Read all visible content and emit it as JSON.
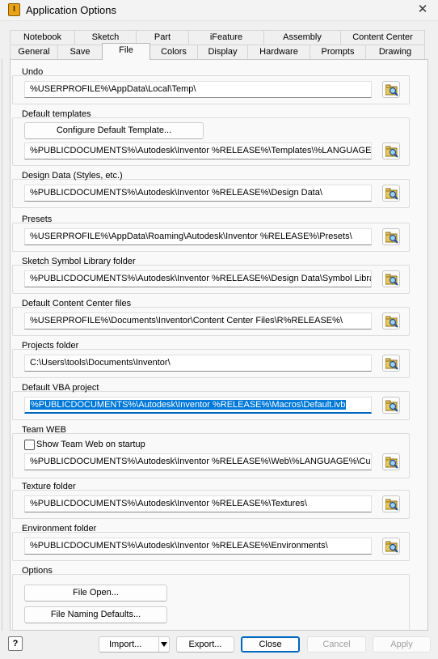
{
  "window": {
    "title": "Application Options",
    "close_glyph": "✕",
    "icon_letter": "I"
  },
  "tabs_back": [
    "Notebook",
    "Sketch",
    "Part",
    "iFeature",
    "Assembly",
    "Content Center"
  ],
  "tabs_front": [
    "General",
    "Save",
    "File",
    "Colors",
    "Display",
    "Hardware",
    "Prompts",
    "Drawing"
  ],
  "active_tab": "File",
  "groups": {
    "undo": {
      "label": "Undo",
      "value": "%USERPROFILE%\\AppData\\Local\\Temp\\"
    },
    "default_templates": {
      "label": "Default templates",
      "button": "Configure Default Template...",
      "value": "%PUBLICDOCUMENTS%\\Autodesk\\Inventor %RELEASE%\\Templates\\%LANGUAGE%\\"
    },
    "design_data": {
      "label": "Design Data (Styles, etc.)",
      "value": "%PUBLICDOCUMENTS%\\Autodesk\\Inventor %RELEASE%\\Design Data\\"
    },
    "presets": {
      "label": "Presets",
      "value": "%USERPROFILE%\\AppData\\Roaming\\Autodesk\\Inventor %RELEASE%\\Presets\\"
    },
    "sketch_symbol": {
      "label": "Sketch Symbol Library folder",
      "value": "%PUBLICDOCUMENTS%\\Autodesk\\Inventor %RELEASE%\\Design Data\\Symbol Library\\"
    },
    "content_center": {
      "label": "Default Content Center files",
      "value": "%USERPROFILE%\\Documents\\Inventor\\Content Center Files\\R%RELEASE%\\"
    },
    "projects": {
      "label": "Projects folder",
      "value": "C:\\Users\\tools\\Documents\\Inventor\\"
    },
    "vba": {
      "label": "Default VBA project",
      "value": "%PUBLICDOCUMENTS%\\Autodesk\\Inventor %RELEASE%\\Macros\\Default.ivb"
    },
    "team_web": {
      "label": "Team WEB",
      "checkbox_label": "Show Team Web on startup",
      "checked": false,
      "value": "%PUBLICDOCUMENTS%\\Autodesk\\Inventor %RELEASE%\\Web\\%LANGUAGE%\\Custom"
    },
    "texture": {
      "label": "Texture folder",
      "value": "%PUBLICDOCUMENTS%\\Autodesk\\Inventor %RELEASE%\\Textures\\"
    },
    "environment": {
      "label": "Environment folder",
      "value": "%PUBLICDOCUMENTS%\\Autodesk\\Inventor %RELEASE%\\Environments\\"
    },
    "options": {
      "label": "Options",
      "file_open": "File Open...",
      "file_naming": "File Naming Defaults..."
    }
  },
  "footer": {
    "help": "?",
    "import": "Import...",
    "export": "Export...",
    "close": "Close",
    "cancel": "Cancel",
    "apply": "Apply"
  }
}
